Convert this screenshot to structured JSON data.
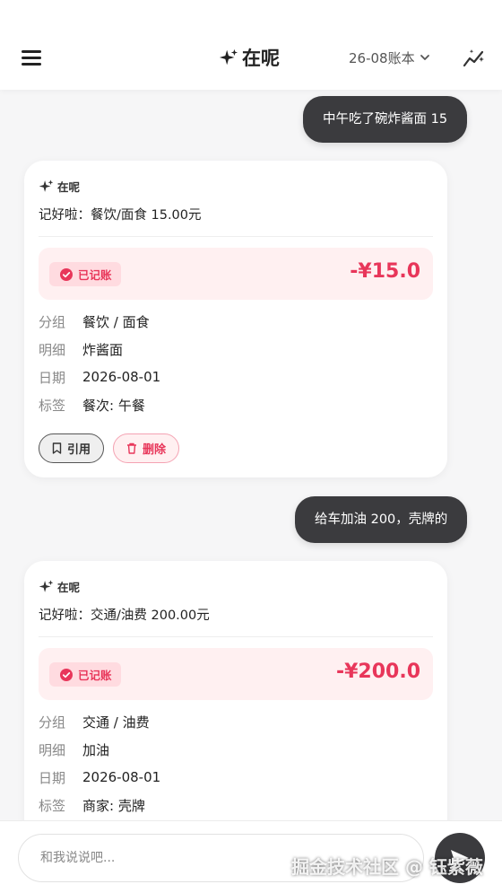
{
  "header": {
    "title": "在呢",
    "ledger_label": "26-08账本",
    "icons": [
      "menu-icon",
      "sparkle-icon",
      "chevron-down-icon",
      "trend-sparkle-icon"
    ]
  },
  "messages": [
    {
      "user_text": "中午吃了碗炸酱面 15"
    },
    {
      "assistant_name": "在呢",
      "reply": "记好啦：餐饮/面食 15.00元",
      "status": "已记账",
      "amount": "-¥15.0",
      "fields": [
        {
          "label": "分组",
          "value": "餐饮 / 面食"
        },
        {
          "label": "明细",
          "value": "炸酱面"
        },
        {
          "label": "日期",
          "value": "2026-08-01"
        },
        {
          "label": "标签",
          "value": "餐次: 午餐"
        }
      ],
      "actions": {
        "quote": "引用",
        "delete": "删除"
      }
    },
    {
      "user_text": "给车加油 200，壳牌的"
    },
    {
      "assistant_name": "在呢",
      "reply": "记好啦：交通/油费 200.00元",
      "status": "已记账",
      "amount": "-¥200.0",
      "fields": [
        {
          "label": "分组",
          "value": "交通 / 油费"
        },
        {
          "label": "明细",
          "value": "加油"
        },
        {
          "label": "日期",
          "value": "2026-08-01"
        },
        {
          "label": "标签",
          "value": "商家: 壳牌"
        }
      ]
    }
  ],
  "composer": {
    "placeholder": "和我说说吧..."
  },
  "watermark": "掘金技术社区 @ 钰紫薇",
  "colors": {
    "accent": "#e8365a",
    "bubble": "#3b3b3e",
    "amount_bg": "#fff0f1"
  }
}
